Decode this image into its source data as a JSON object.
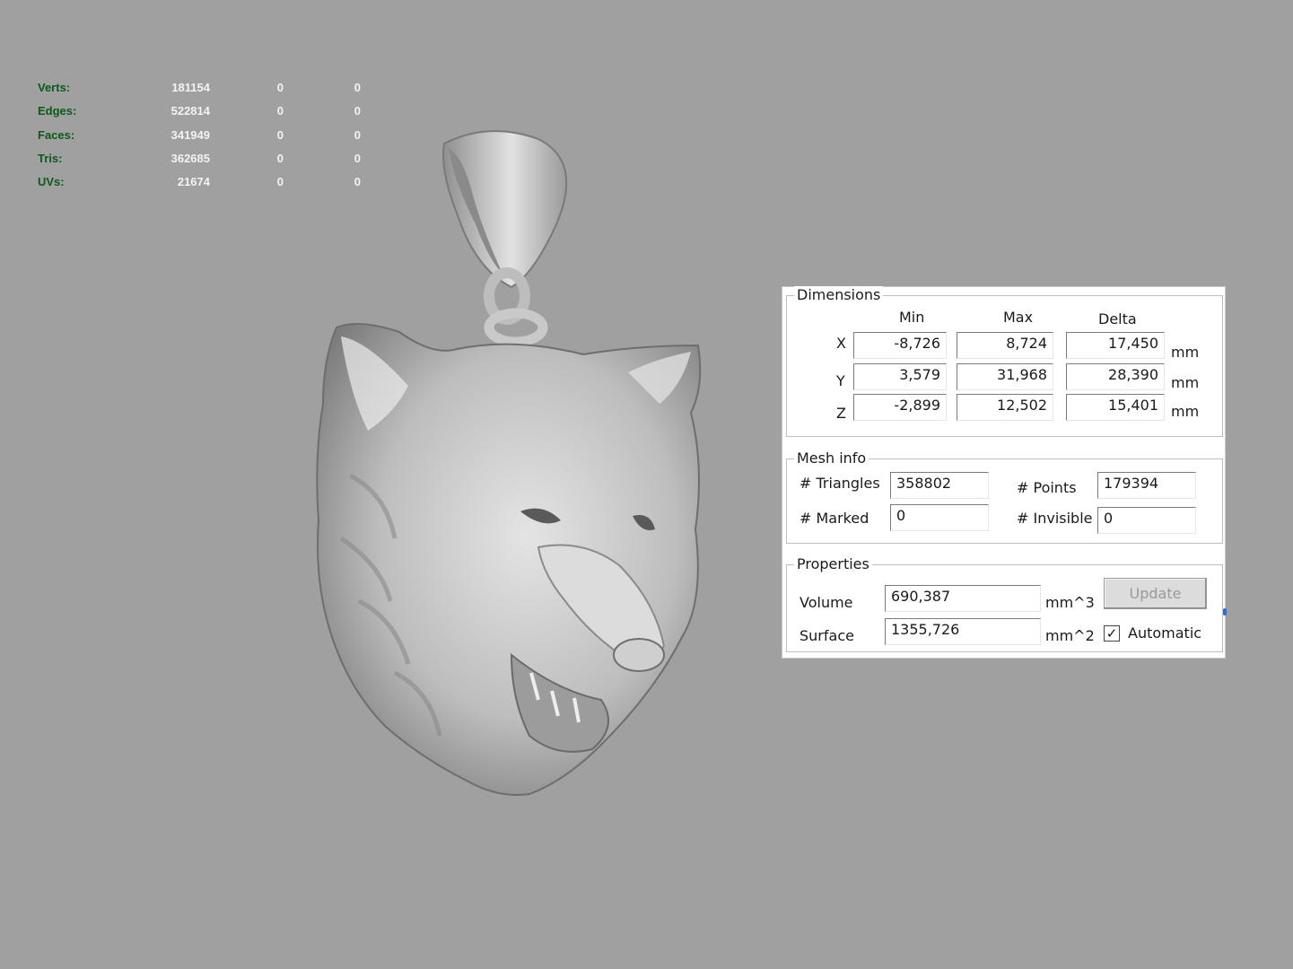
{
  "hud": {
    "rows": [
      {
        "label": "Verts:",
        "v1": "181154",
        "v2": "0",
        "v3": "0"
      },
      {
        "label": "Edges:",
        "v1": "522814",
        "v2": "0",
        "v3": "0"
      },
      {
        "label": "Faces:",
        "v1": "341949",
        "v2": "0",
        "v3": "0"
      },
      {
        "label": "Tris:",
        "v1": "362685",
        "v2": "0",
        "v3": "0"
      },
      {
        "label": "UVs:",
        "v1": "21674",
        "v2": "0",
        "v3": "0"
      }
    ]
  },
  "dimensions": {
    "title": "Dimensions",
    "headers": {
      "min": "Min",
      "max": "Max",
      "delta": "Delta"
    },
    "rows": [
      {
        "axis": "X",
        "min": "-8,726",
        "max": "8,724",
        "delta": "17,450",
        "unit": "mm"
      },
      {
        "axis": "Y",
        "min": "3,579",
        "max": "31,968",
        "delta": "28,390",
        "unit": "mm"
      },
      {
        "axis": "Z",
        "min": "-2,899",
        "max": "12,502",
        "delta": "15,401",
        "unit": "mm"
      }
    ]
  },
  "mesh_info": {
    "title": "Mesh info",
    "triangles_label": "# Triangles",
    "triangles": "358802",
    "points_label": "# Points",
    "points": "179394",
    "marked_label": "# Marked",
    "marked": "0",
    "invisible_label": "# Invisible",
    "invisible": "0"
  },
  "properties": {
    "title": "Properties",
    "volume_label": "Volume",
    "volume": "690,387",
    "volume_unit": "mm^3",
    "surface_label": "Surface",
    "surface": "1355,726",
    "surface_unit": "mm^2",
    "update_label": "Update",
    "automatic_label": "Automatic",
    "automatic_checked": true
  },
  "colors": {
    "background": "#a0a0a0",
    "hud_label": "#0b5a1a",
    "hud_value": "#f3f3f3",
    "model": "#c8c8c8"
  }
}
